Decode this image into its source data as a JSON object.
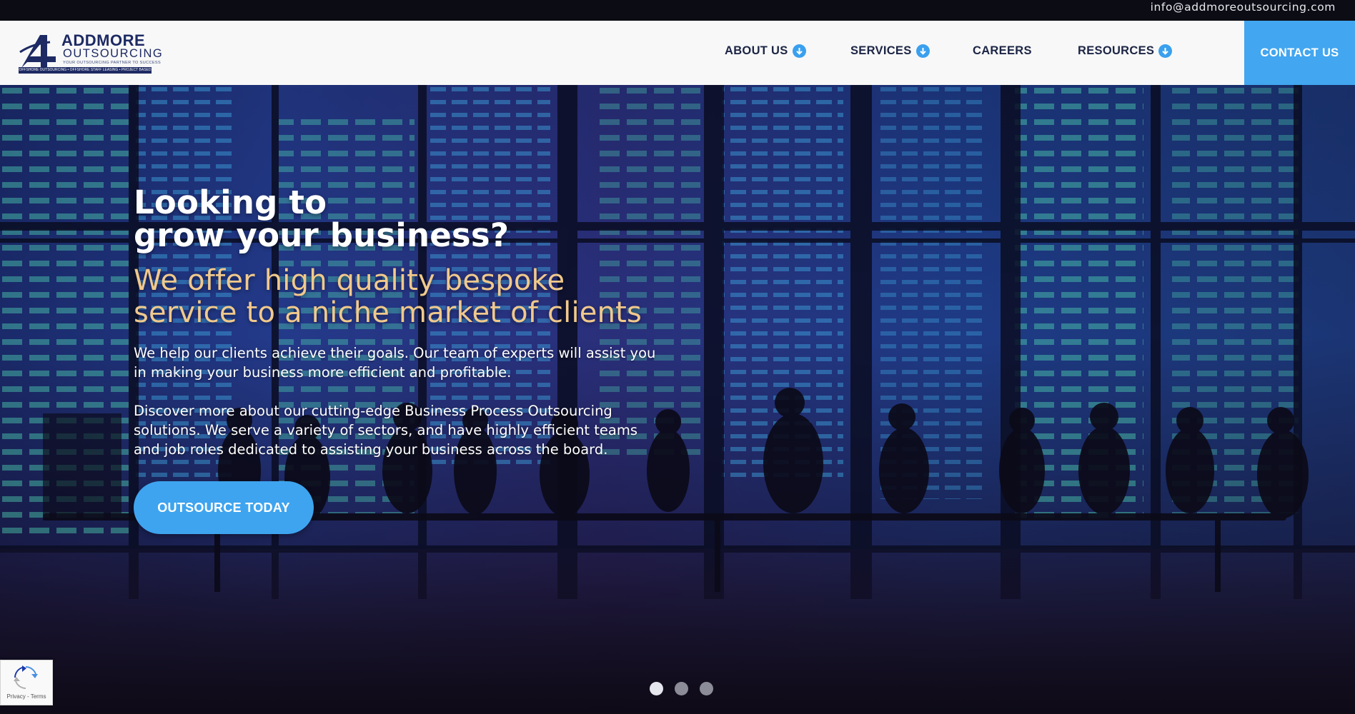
{
  "topbar": {
    "email": "info@addmoreoutsourcing.com"
  },
  "header": {
    "logo": {
      "name_line1": "ADDMORE",
      "name_line2": "OUTSOURCING",
      "tagline": "YOUR OUTSOURCING PARTNER TO SUCCESS",
      "strip": "OFFSHORE OUTSOURCING • OFFSHORE STAFF LEASING • PROJECT BASED"
    },
    "nav": [
      {
        "label": "ABOUT US",
        "dropdown": true,
        "icon": "chevron-down-circle-icon"
      },
      {
        "label": "SERVICES",
        "dropdown": true,
        "icon": "chevron-down-circle-icon"
      },
      {
        "label": "CAREERS",
        "dropdown": false
      },
      {
        "label": "RESOURCES",
        "dropdown": true,
        "icon": "chevron-down-circle-icon"
      }
    ],
    "contact_label": "CONTACT US"
  },
  "hero": {
    "headline_line1": "Looking to",
    "headline_line2": "grow your business?",
    "sub_line1": "We offer high quality bespoke",
    "sub_line2": "service to a niche market of clients",
    "para1_line1": "We help our clients achieve their goals. Our team of experts will assist you",
    "para1_line2": "in making your business more efficient and profitable.",
    "para2_line1": "Discover more about our cutting-edge Business Process Outsourcing",
    "para2_line2": "solutions. We serve a variety of sectors, and have highly efficient teams",
    "para2_line3": "and job roles dedicated to assisting your business across the board.",
    "cta_label": "OUTSOURCE TODAY",
    "slides": {
      "count": 3,
      "active": 1
    }
  },
  "recaptcha": {
    "text": "Privacy - Terms"
  },
  "colors": {
    "accent": "#42a6f0",
    "headline": "#ffffff",
    "subheadline": "#f1c98c",
    "nav_text": "#1c2545",
    "brand": "#1d2a63"
  }
}
